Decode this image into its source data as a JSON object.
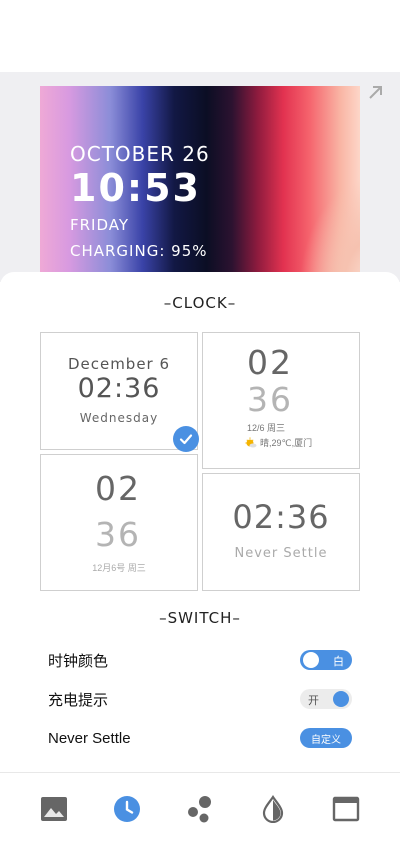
{
  "preview": {
    "date": "OCTOBER 26",
    "time": "10:53",
    "day": "FRIDAY",
    "charging": "CHARGING: 95%"
  },
  "sections": {
    "clock_title": "–CLOCK–",
    "switch_title": "–SWITCH–"
  },
  "clock_styles": [
    {
      "date": "December 6",
      "time": "02:36",
      "day": "Wednesday",
      "selected": true
    },
    {
      "hour": "02",
      "minute": "36",
      "info": "12/6  周三",
      "weather": "晴,29℃,厦门"
    },
    {
      "hour": "02",
      "minute": "36",
      "info": "12月6号  周三"
    },
    {
      "time": "02:36",
      "subtitle": "Never Settle"
    }
  ],
  "settings": [
    {
      "label": "时钟颜色",
      "control": "toggle",
      "value_text": "白",
      "state": "on"
    },
    {
      "label": "充电提示",
      "control": "toggle",
      "value_text": "开",
      "state": "off-style"
    },
    {
      "label": "Never Settle",
      "control": "button",
      "value_text": "自定义"
    }
  ],
  "bottom_nav": [
    "wallpaper-icon",
    "clock-icon",
    "widgets-icon",
    "theme-icon",
    "window-icon"
  ],
  "colors": {
    "accent": "#4a90e2",
    "sheet": "#ffffff",
    "preview_bg": "#efeff2"
  }
}
